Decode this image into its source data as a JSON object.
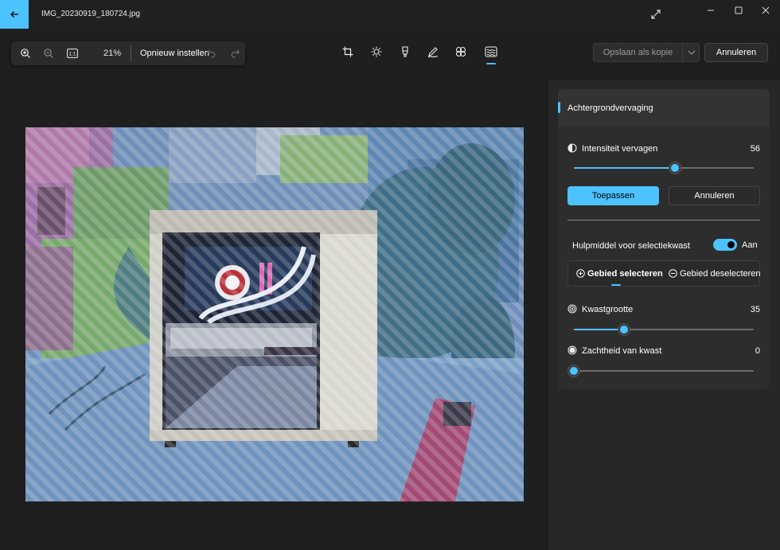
{
  "window": {
    "title": "IMG_20230919_180724.jpg"
  },
  "toolbar": {
    "zoom_in_icon": "zoom-in-icon",
    "zoom_out_icon": "zoom-out-icon",
    "actual_size_label": "1:1",
    "zoom_level": "21%",
    "reset_label": "Opnieuw instellen",
    "undo_icon": "undo-icon",
    "redo_icon": "redo-icon",
    "save_copy_label": "Opslaan als kopie",
    "cancel_label": "Annuleren"
  },
  "tools": [
    "crop-icon",
    "brightness-icon",
    "markup-icon",
    "draw-icon",
    "filter-icon",
    "background-icon"
  ],
  "active_tool": "background-icon",
  "panel": {
    "title": "Achtergrondvervaging",
    "intensity": {
      "label": "Intensiteit vervagen",
      "value": "56",
      "fraction": 0.56
    },
    "apply_label": "Toepassen",
    "cancel_label": "Annuleren",
    "brush_tool": {
      "label": "Hulpmiddel voor selectiekwast",
      "state_label": "Aan",
      "on": true
    },
    "select_area_label": "Gebied selecteren",
    "deselect_area_label": "Gebied deselecteren",
    "brush_size": {
      "label": "Kwastgrootte",
      "value": "35",
      "fraction": 0.28
    },
    "brush_softness": {
      "label": "Zachtheid van kwast",
      "value": "0",
      "fraction": 0.0
    }
  },
  "colors": {
    "accent": "#4cc2ff",
    "background": "#1f1f1f",
    "panel": "#2d2d2d"
  }
}
